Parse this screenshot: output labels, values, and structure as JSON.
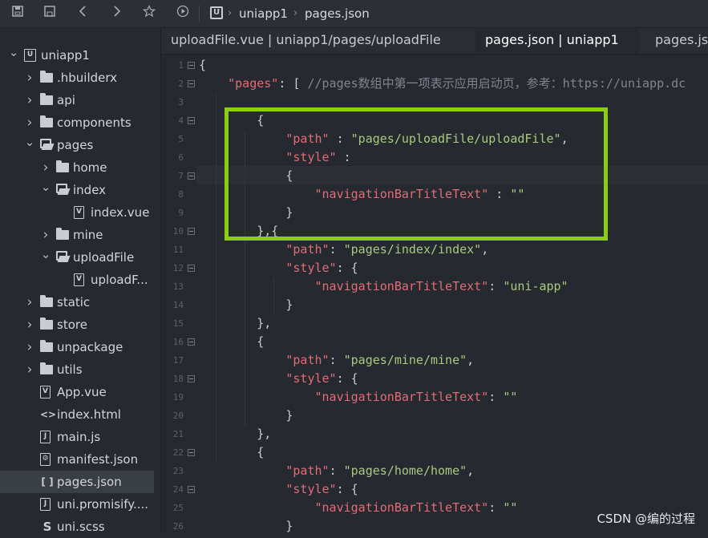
{
  "toolbar": {
    "icons": [
      "save-all-icon",
      "save-icon",
      "back-icon",
      "forward-icon",
      "star-icon",
      "run-icon"
    ],
    "breadcrumb": [
      "uniapp1",
      "pages.json"
    ]
  },
  "sidebar": {
    "items": [
      {
        "label": "uniapp1",
        "level": 0,
        "arrow": "v",
        "icon": "project"
      },
      {
        "label": ".hbuilderx",
        "level": 1,
        "arrow": ">",
        "icon": "folder"
      },
      {
        "label": "api",
        "level": 1,
        "arrow": ">",
        "icon": "folder"
      },
      {
        "label": "components",
        "level": 1,
        "arrow": ">",
        "icon": "folder"
      },
      {
        "label": "pages",
        "level": 1,
        "arrow": "v",
        "icon": "folder-open"
      },
      {
        "label": "home",
        "level": 2,
        "arrow": ">",
        "icon": "folder"
      },
      {
        "label": "index",
        "level": 2,
        "arrow": "v",
        "icon": "folder-open"
      },
      {
        "label": "index.vue",
        "level": 3,
        "arrow": "",
        "icon": "vue"
      },
      {
        "label": "mine",
        "level": 2,
        "arrow": ">",
        "icon": "folder"
      },
      {
        "label": "uploadFile",
        "level": 2,
        "arrow": "v",
        "icon": "folder-open"
      },
      {
        "label": "uploadF...",
        "level": 3,
        "arrow": "",
        "icon": "vue"
      },
      {
        "label": "static",
        "level": 1,
        "arrow": ">",
        "icon": "folder"
      },
      {
        "label": "store",
        "level": 1,
        "arrow": ">",
        "icon": "folder"
      },
      {
        "label": "unpackage",
        "level": 1,
        "arrow": ">",
        "icon": "folder"
      },
      {
        "label": "utils",
        "level": 1,
        "arrow": ">",
        "icon": "folder"
      },
      {
        "label": "App.vue",
        "level": 1,
        "arrow": "",
        "icon": "vue"
      },
      {
        "label": "index.html",
        "level": 1,
        "arrow": "",
        "icon": "html"
      },
      {
        "label": "main.js",
        "level": 1,
        "arrow": "",
        "icon": "js"
      },
      {
        "label": "manifest.json",
        "level": 1,
        "arrow": "",
        "icon": "gear"
      },
      {
        "label": "pages.json",
        "level": 1,
        "arrow": "",
        "icon": "json",
        "selected": true
      },
      {
        "label": "uni.promisify....",
        "level": 1,
        "arrow": "",
        "icon": "js"
      },
      {
        "label": "uni.scss",
        "level": 1,
        "arrow": "",
        "icon": "scss"
      }
    ]
  },
  "tabs": [
    {
      "label": "uploadFile.vue | uniapp1/pages/uploadFile",
      "active": false
    },
    {
      "label": "pages.json | uniapp1",
      "active": true
    },
    {
      "label": "pages.js",
      "active": false
    }
  ],
  "editor": {
    "lines": [
      {
        "n": "1",
        "fold": true,
        "text": [
          [
            "p",
            "{"
          ]
        ]
      },
      {
        "n": "2",
        "fold": true,
        "text": [
          [
            "p",
            "    "
          ],
          [
            "k",
            "\"pages\""
          ],
          [
            "p",
            ": [ "
          ],
          [
            "c",
            "//pages数组中第一项表示应用启动页，参考：https://uniapp.dc"
          ]
        ]
      },
      {
        "n": "3",
        "fold": false,
        "text": [
          [
            "p",
            ""
          ]
        ]
      },
      {
        "n": "4",
        "fold": true,
        "text": [
          [
            "p",
            "        {"
          ]
        ]
      },
      {
        "n": "5",
        "fold": false,
        "text": [
          [
            "p",
            "            "
          ],
          [
            "k",
            "\"path\""
          ],
          [
            "p",
            " : "
          ],
          [
            "s",
            "\"pages/uploadFile/uploadFile\""
          ],
          [
            "p",
            ","
          ]
        ]
      },
      {
        "n": "6",
        "fold": false,
        "text": [
          [
            "p",
            "            "
          ],
          [
            "k",
            "\"style\""
          ],
          [
            "p",
            " :"
          ]
        ]
      },
      {
        "n": "7",
        "fold": true,
        "text": [
          [
            "p",
            "            {"
          ]
        ]
      },
      {
        "n": "8",
        "fold": false,
        "text": [
          [
            "p",
            "                "
          ],
          [
            "k",
            "\"navigationBarTitleText\""
          ],
          [
            "p",
            " : "
          ],
          [
            "s",
            "\"\""
          ]
        ]
      },
      {
        "n": "9",
        "fold": false,
        "text": [
          [
            "p",
            "            }"
          ]
        ]
      },
      {
        "n": "10",
        "fold": true,
        "text": [
          [
            "p",
            "        },{"
          ]
        ]
      },
      {
        "n": "11",
        "fold": false,
        "text": [
          [
            "p",
            "            "
          ],
          [
            "k",
            "\"path\""
          ],
          [
            "p",
            ": "
          ],
          [
            "s",
            "\"pages/index/index\""
          ],
          [
            "p",
            ","
          ]
        ]
      },
      {
        "n": "12",
        "fold": true,
        "text": [
          [
            "p",
            "            "
          ],
          [
            "k",
            "\"style\""
          ],
          [
            "p",
            ": {"
          ]
        ]
      },
      {
        "n": "13",
        "fold": false,
        "text": [
          [
            "p",
            "                "
          ],
          [
            "k",
            "\"navigationBarTitleText\""
          ],
          [
            "p",
            ": "
          ],
          [
            "s",
            "\"uni-app\""
          ]
        ]
      },
      {
        "n": "14",
        "fold": false,
        "text": [
          [
            "p",
            "            }"
          ]
        ]
      },
      {
        "n": "15",
        "fold": false,
        "text": [
          [
            "p",
            "        },"
          ]
        ]
      },
      {
        "n": "16",
        "fold": true,
        "text": [
          [
            "p",
            "        {"
          ]
        ]
      },
      {
        "n": "17",
        "fold": false,
        "text": [
          [
            "p",
            "            "
          ],
          [
            "k",
            "\"path\""
          ],
          [
            "p",
            ": "
          ],
          [
            "s",
            "\"pages/mine/mine\""
          ],
          [
            "p",
            ","
          ]
        ]
      },
      {
        "n": "18",
        "fold": true,
        "text": [
          [
            "p",
            "            "
          ],
          [
            "k",
            "\"style\""
          ],
          [
            "p",
            ": {"
          ]
        ]
      },
      {
        "n": "19",
        "fold": false,
        "text": [
          [
            "p",
            "                "
          ],
          [
            "k",
            "\"navigationBarTitleText\""
          ],
          [
            "p",
            ": "
          ],
          [
            "s",
            "\"\""
          ]
        ]
      },
      {
        "n": "20",
        "fold": false,
        "text": [
          [
            "p",
            "            }"
          ]
        ]
      },
      {
        "n": "21",
        "fold": false,
        "text": [
          [
            "p",
            "        },"
          ]
        ]
      },
      {
        "n": "22",
        "fold": true,
        "text": [
          [
            "p",
            "        {"
          ]
        ]
      },
      {
        "n": "23",
        "fold": false,
        "text": [
          [
            "p",
            "            "
          ],
          [
            "k",
            "\"path\""
          ],
          [
            "p",
            ": "
          ],
          [
            "s",
            "\"pages/home/home\""
          ],
          [
            "p",
            ","
          ]
        ]
      },
      {
        "n": "24",
        "fold": true,
        "text": [
          [
            "p",
            "            "
          ],
          [
            "k",
            "\"style\""
          ],
          [
            "p",
            ": {"
          ]
        ]
      },
      {
        "n": "25",
        "fold": false,
        "text": [
          [
            "p",
            "                "
          ],
          [
            "k",
            "\"navigationBarTitleText\""
          ],
          [
            "p",
            ": "
          ],
          [
            "s",
            "\"\""
          ]
        ]
      },
      {
        "n": "26",
        "fold": false,
        "text": [
          [
            "p",
            "            }"
          ]
        ]
      }
    ]
  },
  "colors": {
    "highlight_box": "#8ccc14",
    "key": "#e06c75",
    "string": "#a8c97f",
    "comment": "#7f848e"
  },
  "watermark": "CSDN @编的过程"
}
